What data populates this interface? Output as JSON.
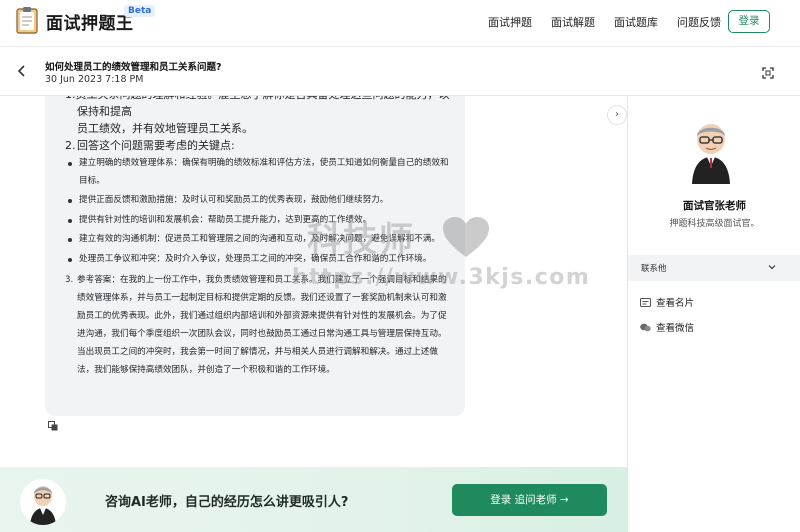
{
  "header": {
    "brand": "面试押题王",
    "badge": "Beta",
    "nav": [
      "面试押题",
      "面试解题",
      "面试题库",
      "问题反馈"
    ],
    "login": "登录"
  },
  "subheader": {
    "question": "如何处理员工的绩效管理和员工关系问题?",
    "date": "30 Jun 2023 7:18 PM"
  },
  "answer": {
    "point2_tail_line1": "员工关系问题的理解和经验。雇主想了解你是否具备处理这些问题的能力，以保持和提高",
    "point2_tail_line2": "员工绩效，并有效地管理员工关系。",
    "point3_num": "2.",
    "point3_title": "回答这个问题需要考虑的关键点:",
    "bullets": [
      "建立明确的绩效管理体系：确保有明确的绩效标准和评估方法，使员工知道如何衡量自己的绩效和目标。",
      "提供正面反馈和激励措施：及时认可和奖励员工的优秀表现，鼓励他们继续努力。",
      "提供有针对性的培训和发展机会：帮助员工提升能力，达到更高的工作绩效。",
      "建立有效的沟通机制：促进员工和管理层之间的沟通和互动，及时解决问题，避免误解和不满。",
      "处理员工争议和冲突：及时介入争议，处理员工之间的冲突，确保员工合作和谐的工作环境。"
    ],
    "point4_num": "3.",
    "point4_text": "参考答案：在我的上一份工作中，我负责绩效管理和员工关系。我们建立了一个强调目标和结果的绩效管理体系，并与员工一起制定目标和提供定期的反馈。我们还设置了一套奖励机制来认可和激励员工的优秀表现。此外，我们通过组织内部培训和外部资源来提供有针对性的发展机会。为了促进沟通，我们每个季度组织一次团队会议，同时也鼓励员工通过日常沟通工具与管理层保持互动。当出现员工之间的冲突时，我会第一时间了解情况，并与相关人员进行调解和解决。通过上述做法，我们能够保持高绩效团队，并创造了一个积极和谐的工作环境。"
  },
  "sidebar": {
    "name": "面试官张老师",
    "role": "押题科技高级面试官。",
    "contact_label": "联系他",
    "items": [
      "查看名片",
      "查看微信"
    ]
  },
  "watermark": {
    "text": "科技师",
    "url": "https://www.3kjs.com"
  },
  "banner": {
    "text": "咨询AI老师，自己的经历怎么讲更吸引人?",
    "button": "登录 追问老师 →"
  },
  "colors": {
    "accent": "#1e8a5e",
    "badge": "#2f6fd6",
    "bubble_bg": "#f1f3f6"
  }
}
